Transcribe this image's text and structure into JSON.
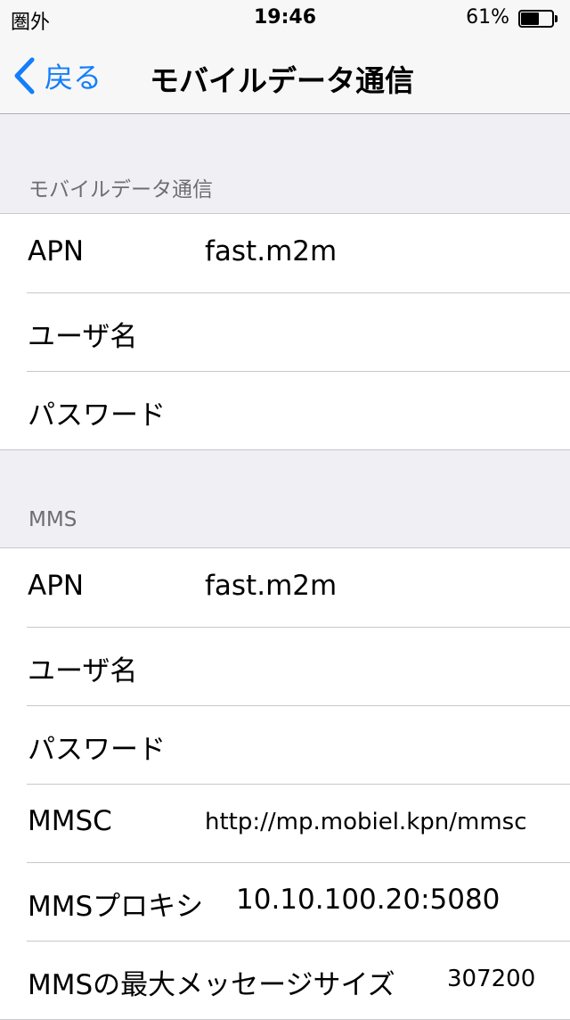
{
  "status_bar": {
    "carrier": "圏外",
    "time": "19:46",
    "battery_percent": "61%",
    "battery_level": 0.61
  },
  "nav": {
    "back_label": "戻る",
    "title": "モバイルデータ通信"
  },
  "sections": {
    "cellular": {
      "header": "モバイルデータ通信",
      "rows": [
        {
          "label": "APN",
          "value": "fast.m2m"
        },
        {
          "label": "ユーザ名",
          "value": ""
        },
        {
          "label": "パスワード",
          "value": ""
        }
      ]
    },
    "mms": {
      "header": "MMS",
      "rows": [
        {
          "label": "APN",
          "value": "fast.m2m"
        },
        {
          "label": "ユーザ名",
          "value": ""
        },
        {
          "label": "パスワード",
          "value": ""
        },
        {
          "label": "MMSC",
          "value": "http://mp.mobiel.kpn/mmsc"
        },
        {
          "label": "MMSプロキシ",
          "value": "10.10.100.20:5080"
        },
        {
          "label": "MMSの最大メッセージサイズ",
          "value": "307200"
        }
      ]
    }
  },
  "colors": {
    "accent": "#147efb",
    "background": "#efeff4",
    "separator": "#c8c7cc",
    "header_text": "#6d6d72"
  }
}
